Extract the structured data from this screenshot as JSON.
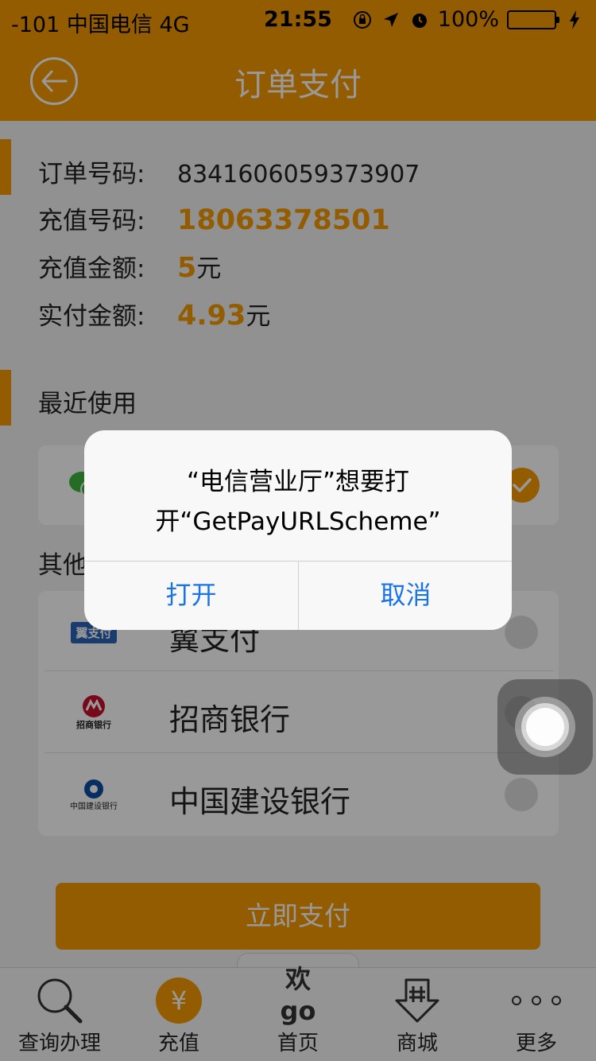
{
  "statusbar": {
    "carrier": "-101 中国电信  4G",
    "time": "21:55",
    "battery": "100%",
    "battery_level": 1.0
  },
  "navbar": {
    "title": "订单支付"
  },
  "order": {
    "order_no_label": "订单号码:",
    "order_no": "8341606059373907",
    "phone_label": "充值号码:",
    "phone": "18063378501",
    "amount_label": "充值金额:",
    "amount": "5",
    "amount_unit": "元",
    "paid_label": "实付金额:",
    "paid": "4.93",
    "paid_unit": "元"
  },
  "recent": {
    "title": "最近使用"
  },
  "other": {
    "title": "其他",
    "banks": [
      {
        "name": "翼支付",
        "logo_text": "翼支付"
      },
      {
        "name": "招商银行",
        "logo_text": "招商银行"
      },
      {
        "name": "中国建设银行",
        "logo_text": "中国建设银行"
      }
    ]
  },
  "pay_button": "立即支付",
  "tabs": [
    {
      "label": "查询办理",
      "icon": "search-icon"
    },
    {
      "label": "充值",
      "icon": "yuan-icon",
      "icon_glyph": "¥"
    },
    {
      "label": "首页",
      "icon": "home-logo-icon",
      "logo_text": "欢go"
    },
    {
      "label": "商城",
      "icon": "mall-icon"
    },
    {
      "label": "更多",
      "icon": "more-icon"
    }
  ],
  "alert": {
    "message": "“电信营业厅”想要打开“GetPayURLScheme”",
    "open_label": "打开",
    "cancel_label": "取消"
  },
  "colors": {
    "accent": "#f59a00",
    "link": "#1a73e8"
  }
}
